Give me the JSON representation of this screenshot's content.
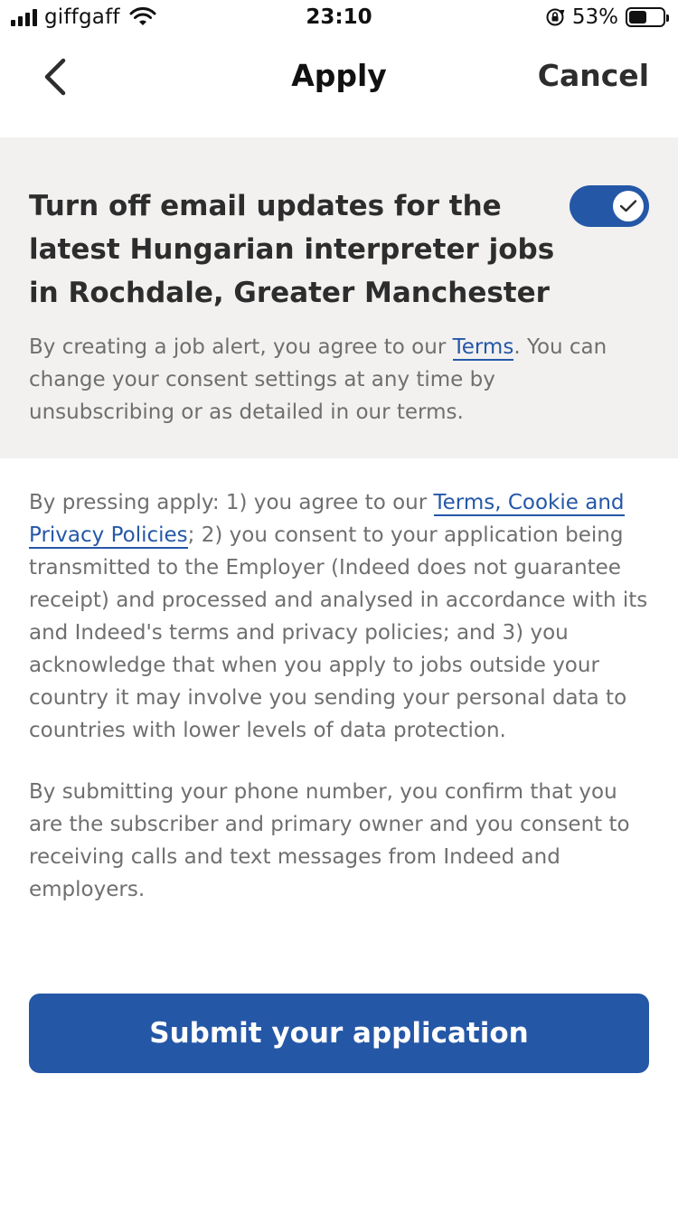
{
  "status_bar": {
    "carrier": "giffgaff",
    "time": "23:10",
    "battery_percent": "53%",
    "battery_level": 0.53,
    "icons": [
      "signal-icon",
      "wifi-icon",
      "orientation-lock-icon",
      "battery-icon"
    ]
  },
  "nav": {
    "back_icon": "chevron-left-icon",
    "title": "Apply",
    "cancel_label": "Cancel"
  },
  "job_alert": {
    "heading": "Turn off email updates for the latest Hungarian interpreter jobs in Rochdale, Greater Manchester",
    "toggle_on": true,
    "toggle_icon": "checkmark-icon",
    "consent_prefix": "By creating a job alert, you agree to our ",
    "consent_link": "Terms",
    "consent_suffix": ". You can change your consent settings at any time by unsubscribing or as detailed in our terms."
  },
  "legal": {
    "apply_prefix": "By pressing apply: 1) you agree to our ",
    "apply_link": "Terms, Cookie and Privacy Policies",
    "apply_suffix": "; 2) you consent to your application being transmitted to the Employer (Indeed does not guarantee receipt) and processed and analysed in accordance with its and Indeed's terms and privacy policies; and 3) you acknowledge that when you apply to jobs outside your country it may involve you sending your personal data to countries with lower levels of data protection.",
    "phone_text": "By submitting your phone number, you confirm that you are the subscriber and primary owner and you consent to receiving calls and text messages from Indeed and employers."
  },
  "submit": {
    "label": "Submit your application"
  },
  "colors": {
    "accent": "#2557a7",
    "panel_bg": "#f2f1f0",
    "body_text": "#6f6f6f",
    "heading_text": "#2d2d2d"
  }
}
